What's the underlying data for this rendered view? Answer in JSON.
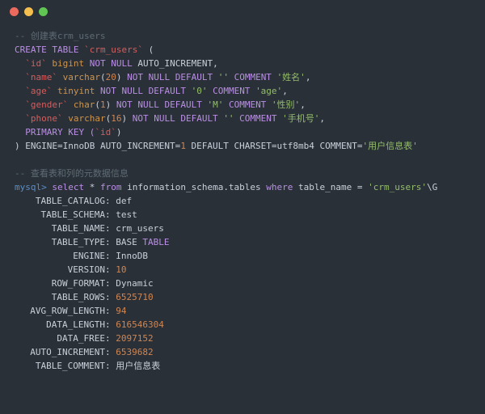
{
  "traffic": {
    "red": "#ed6a5e",
    "yellow": "#f5bf4f",
    "green": "#61c554"
  },
  "comment1": "-- 创建表crm_users",
  "ddl": {
    "l1_a": "CREATE TABLE",
    "l1_b": "`crm_users`",
    "l1_c": " (",
    "l2_a": "  ",
    "l2_id": "`id`",
    "l2_sp": " ",
    "l2_ty": "bigint",
    "l2_nn": " NOT NULL",
    "l2_ai": " AUTO_INCREMENT,",
    "l3_a": "  ",
    "l3_id": "`name`",
    "l3_sp": " ",
    "l3_ty": "varchar",
    "l3_paren": "(",
    "l3_n": "20",
    "l3_paren2": ")",
    "l3_nn": " NOT NULL",
    "l3_def": " DEFAULT ",
    "l3_dv": "''",
    "l3_com": " COMMENT ",
    "l3_cv": "'姓名'",
    "l3_end": ",",
    "l4_a": "  ",
    "l4_id": "`age`",
    "l4_sp": " ",
    "l4_ty": "tinyint",
    "l4_nn": " NOT NULL",
    "l4_def": " DEFAULT ",
    "l4_dv": "'0'",
    "l4_com": " COMMENT ",
    "l4_cv": "'age'",
    "l4_end": ",",
    "l5_a": "  ",
    "l5_id": "`gender`",
    "l5_sp": " ",
    "l5_ty": "char",
    "l5_paren": "(",
    "l5_n": "1",
    "l5_paren2": ")",
    "l5_nn": " NOT NULL",
    "l5_def": " DEFAULT ",
    "l5_dv": "'M'",
    "l5_com": " COMMENT ",
    "l5_cv": "'性别'",
    "l5_end": ",",
    "l6_a": "  ",
    "l6_id": "`phone`",
    "l6_sp": " ",
    "l6_ty": "varchar",
    "l6_paren": "(",
    "l6_n": "16",
    "l6_paren2": ")",
    "l6_nn": " NOT NULL",
    "l6_def": " DEFAULT ",
    "l6_dv": "''",
    "l6_com": " COMMENT ",
    "l6_cv": "'手机号'",
    "l6_end": ",",
    "l7": "  PRIMARY KEY (",
    "l7_id": "`id`",
    "l7_end": ")",
    "l8_a": ") ENGINE=InnoDB AUTO_INCREMENT=",
    "l8_n": "1",
    "l8_b": " DEFAULT CHARSET=utf8mb4 COMMENT=",
    "l8_cv": "'用户信息表'"
  },
  "comment2": "-- 查看表和列的元数据信息",
  "query": {
    "prompt": "mysql>",
    "sel": " select",
    "star": " * ",
    "from": "from",
    "tbl": " information_schema.tables ",
    "where": "where",
    "cond_a": " table_name = ",
    "cond_v": "'crm_users'",
    "tail": "\\G"
  },
  "rows": [
    {
      "k": "TABLE_CATALOG",
      "v": "def",
      "num": false
    },
    {
      "k": "TABLE_SCHEMA",
      "v": "test",
      "num": false
    },
    {
      "k": "TABLE_NAME",
      "v": "crm_users",
      "num": false
    },
    {
      "k": "TABLE_TYPE",
      "v": "BASE TABLE",
      "num": false,
      "split": true,
      "v1": "BASE ",
      "v2": "TABLE"
    },
    {
      "k": "ENGINE",
      "v": "InnoDB",
      "num": false
    },
    {
      "k": "VERSION",
      "v": "10",
      "num": true
    },
    {
      "k": "ROW_FORMAT",
      "v": "Dynamic",
      "num": false
    },
    {
      "k": "TABLE_ROWS",
      "v": "6525710",
      "num": true
    },
    {
      "k": "AVG_ROW_LENGTH",
      "v": "94",
      "num": true
    },
    {
      "k": "DATA_LENGTH",
      "v": "616546304",
      "num": true
    },
    {
      "k": "DATA_FREE",
      "v": "2097152",
      "num": true
    },
    {
      "k": "AUTO_INCREMENT",
      "v": "6539682",
      "num": true
    },
    {
      "k": "TABLE_COMMENT",
      "v": "用户信息表",
      "num": false
    }
  ]
}
